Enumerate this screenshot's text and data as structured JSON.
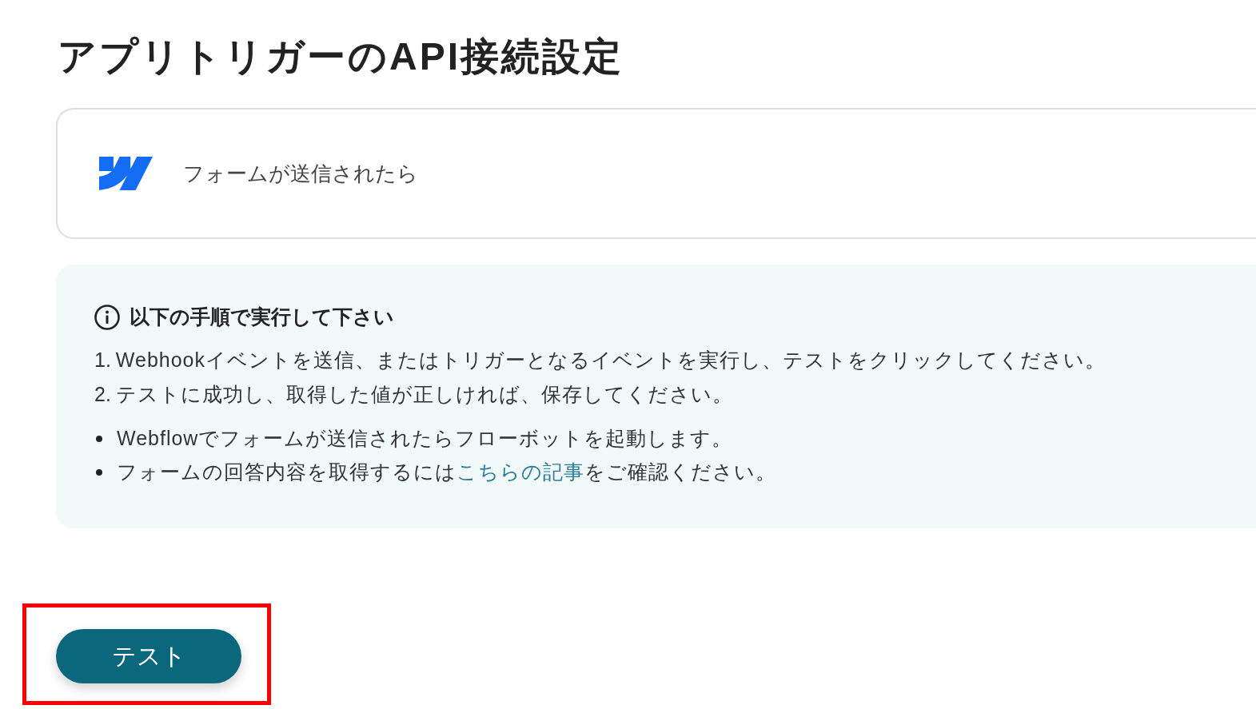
{
  "page_title": "アプリトリガーのAPI接続設定",
  "trigger_card": {
    "label": "フォームが送信されたら"
  },
  "instructions": {
    "heading": "以下の手順で実行して下さい",
    "steps": [
      {
        "number": "1.",
        "text": "Webhookイベントを送信、またはトリガーとなるイベントを実行し、テストをクリックしてください。"
      },
      {
        "number": "2.",
        "text": "テストに成功し、取得した値が正しければ、保存してください。"
      }
    ],
    "notes": [
      {
        "segments": [
          {
            "kind": "text",
            "text": "Webflowでフォームが送信されたらフローボットを起動します。"
          }
        ]
      },
      {
        "segments": [
          {
            "kind": "text",
            "text": "フォームの回答内容を取得するには"
          },
          {
            "kind": "link",
            "text": "こちらの記事"
          },
          {
            "kind": "text",
            "text": "をご確認ください。"
          }
        ]
      }
    ]
  },
  "test_button": {
    "label": "テスト",
    "highlighted": true
  }
}
